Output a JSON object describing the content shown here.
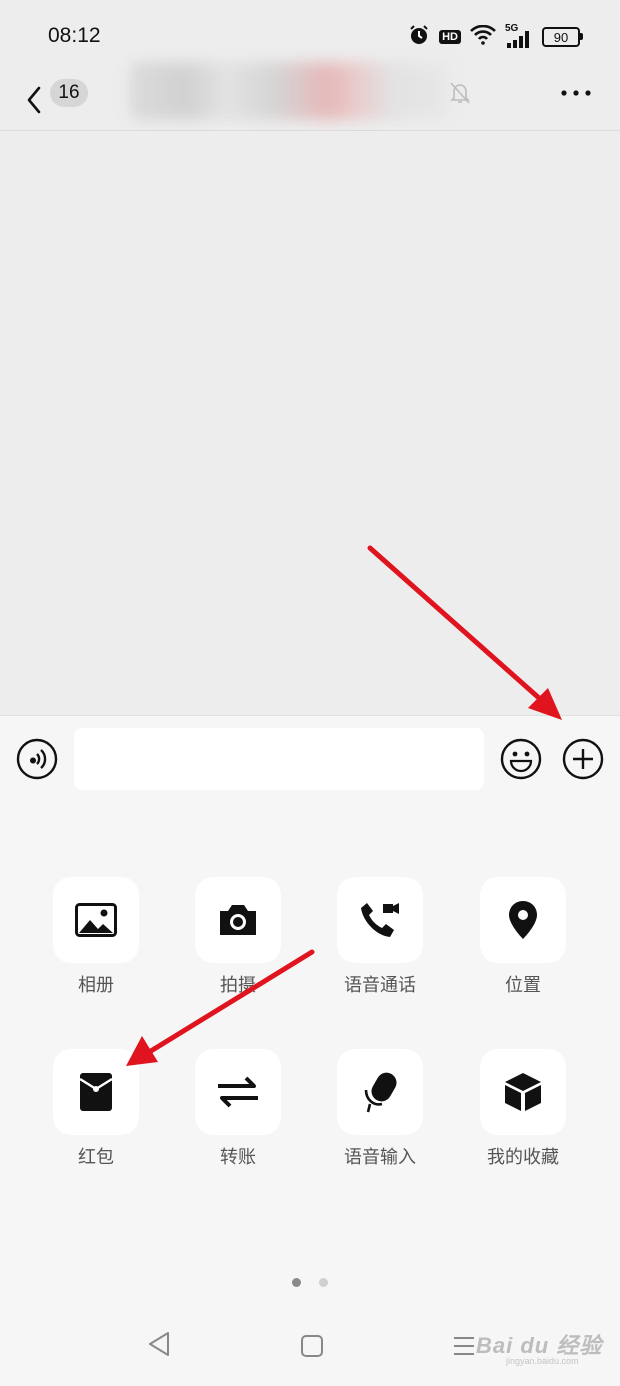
{
  "status_bar": {
    "time": "08:12",
    "hd_label": "HD",
    "network_label": "5G",
    "battery_level": "90"
  },
  "header": {
    "unread_count": "16"
  },
  "input_bar": {
    "message_value": "",
    "message_placeholder": ""
  },
  "panel": {
    "page_count": 2,
    "current_page": 1,
    "items": [
      {
        "label": "相册",
        "icon": "album-icon"
      },
      {
        "label": "拍摄",
        "icon": "camera-icon"
      },
      {
        "label": "语音通话",
        "icon": "voice-video-call-icon"
      },
      {
        "label": "位置",
        "icon": "location-pin-icon"
      },
      {
        "label": "红包",
        "icon": "red-packet-icon"
      },
      {
        "label": "转账",
        "icon": "transfer-icon"
      },
      {
        "label": "语音输入",
        "icon": "microphone-icon"
      },
      {
        "label": "我的收藏",
        "icon": "favorites-cube-icon"
      }
    ]
  },
  "watermark": {
    "brand": "Bai du 经验",
    "url": "jingyan.baidu.com"
  },
  "colors": {
    "background": "#ededed",
    "panel": "#f6f6f6",
    "annotation_arrow": "#e0141e"
  }
}
